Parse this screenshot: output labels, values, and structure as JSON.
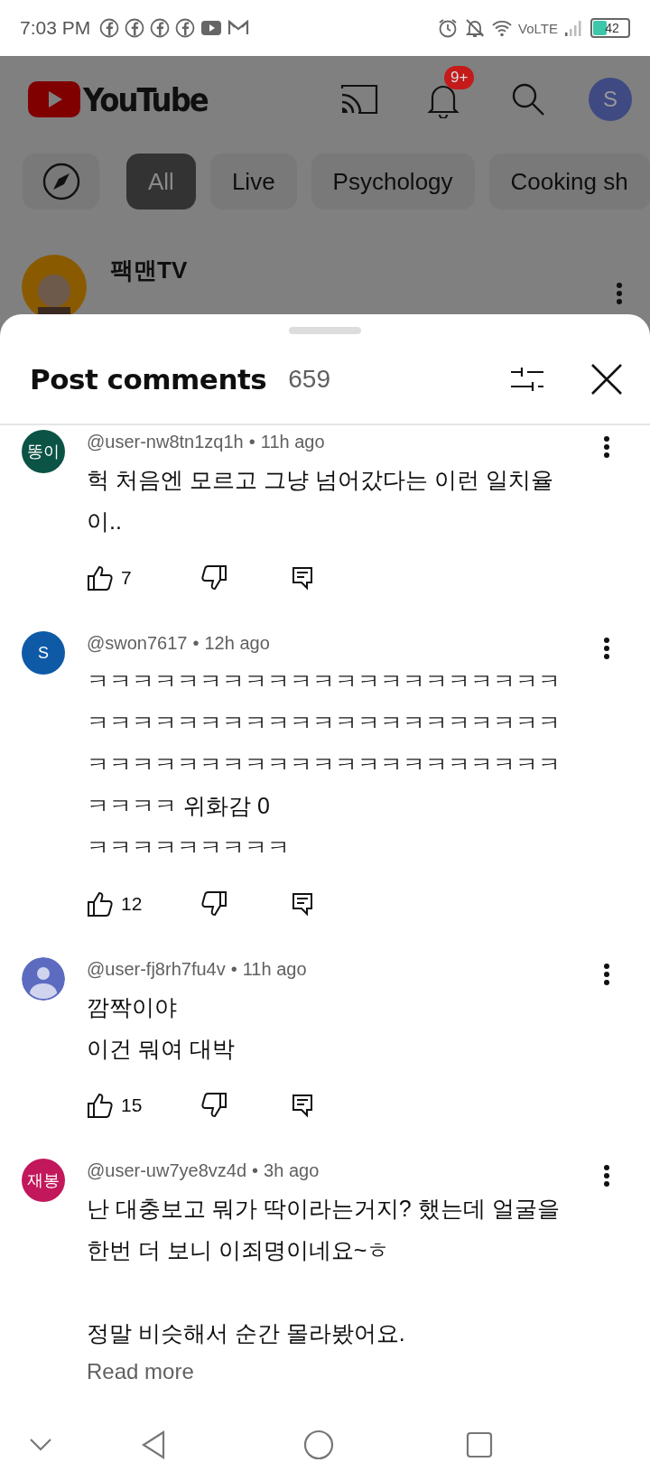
{
  "status_bar": {
    "time": "7:03 PM",
    "network": "VoLTE",
    "battery": "42"
  },
  "app_bar": {
    "logo_text": "YouTube",
    "notification_badge": "9+",
    "account_initial": "S"
  },
  "chips": [
    {
      "label": "All",
      "selected": true
    },
    {
      "label": "Live",
      "selected": false
    },
    {
      "label": "Psychology",
      "selected": false
    },
    {
      "label": "Cooking sh",
      "selected": false
    }
  ],
  "post": {
    "channel": "팩맨TV"
  },
  "sheet": {
    "title": "Post comments",
    "count": "659"
  },
  "comments": [
    {
      "kind": "initials",
      "avatar_text": "똥이",
      "color": "#0b5345",
      "author": "@user-nw8tn1zq1h",
      "separator": "•",
      "time": "11h ago",
      "text": "헉 처음엔 모르고 그냥 넘어갔다는 이런 일치율이..",
      "likes": "7"
    },
    {
      "kind": "initials",
      "avatar_text": "S",
      "color": "#0e5aa7",
      "author": "@swon7617",
      "separator": "•",
      "time": "12h ago",
      "text": "ㅋㅋㅋㅋㅋㅋㅋㅋㅋㅋㅋㅋㅋㅋㅋㅋㅋㅋㅋㅋㅋㅋㅋㅋㅋㅋㅋㅋㅋㅋㅋㅋㅋㅋㅋㅋㅋㅋㅋㅋㅋㅋㅋㅋㅋㅋㅋㅋㅋㅋㅋㅋㅋㅋㅋㅋㅋㅋㅋㅋㅋㅋㅋㅋㅋㅋㅋ 위화감 0\nㅋㅋㅋㅋㅋㅋㅋㅋㅋ",
      "likes": "12"
    },
    {
      "kind": "silhouette",
      "color": "#5c6bc0",
      "author": "@user-fj8rh7fu4v",
      "separator": "•",
      "time": "11h ago",
      "text": "깜짝이야\n이건 뭐여  대박",
      "likes": "15"
    },
    {
      "kind": "initials",
      "avatar_text": "재봉",
      "color": "#c2185b",
      "author": "@user-uw7ye8vz4d",
      "separator": "•",
      "time": "3h ago",
      "text": "난 대충보고 뭐가 딱이라는거지? 했는데 얼굴을 한번 더 보니 이죄명이네요~ㅎ\n\n정말 비슷해서 순간 몰라봤어요.",
      "read_more": "Read more"
    }
  ]
}
